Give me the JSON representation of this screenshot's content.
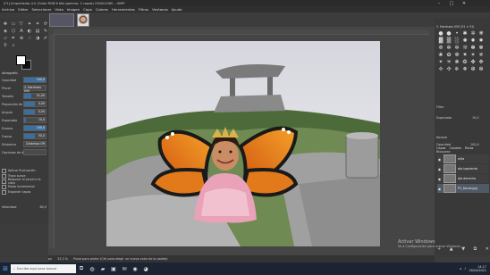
{
  "window": {
    "title": "[*1] (importada)-4.0 (Color RGB 8 bits gamma, 2 capas) 2340x1560 – GIMP",
    "controls": [
      "–",
      "□",
      "✕"
    ]
  },
  "menu": [
    "Archivo",
    "Editar",
    "Seleccionar",
    "Vista",
    "Imagen",
    "Capa",
    "Colores",
    "Herramientas",
    "Filtros",
    "Ventanas",
    "Ayuda"
  ],
  "tool_options": {
    "title": "Aerografo",
    "rows": [
      {
        "label": "Opacidad",
        "value": "100,0",
        "fill": 1.0
      },
      {
        "label": "Pincel",
        "value": "2. Hardness 050",
        "fill": 0.0
      },
      {
        "label": "Tamaño",
        "value": "51,00",
        "fill": 0.35
      },
      {
        "label": "Proporción de a...",
        "value": "0,00",
        "fill": 0.5
      },
      {
        "label": "Ángulo",
        "value": "0,00",
        "fill": 0.5
      },
      {
        "label": "Espaciado",
        "value": "10,0",
        "fill": 0.1
      },
      {
        "label": "Dureza",
        "value": "100,0",
        "fill": 1.0
      },
      {
        "label": "Fuerza",
        "value": "50,0",
        "fill": 0.5
      },
      {
        "label": "Dinámica",
        "value": "Dinámica Off",
        "fill": 0.0
      },
      {
        "label": "Opciones de dinámica",
        "value": "",
        "fill": 0.0
      }
    ],
    "checks": [
      "Aplicar fluctuación",
      "Trazo suave",
      "Bloquear el pincel a la vista",
      "Modo incremental",
      "Expandir capas"
    ],
    "footer": [
      "Velocidad",
      "80,0"
    ]
  },
  "brushes_panel": {
    "header": "2. Hardness 050 (51 × 51)",
    "filter": "Filtro",
    "mode_label": "Espaciado",
    "spacing": "10,0"
  },
  "layers_panel": {
    "tabs": [
      "Capas",
      "Canales",
      "Rutas"
    ],
    "mode": "Normal",
    "opacity_label": "Opacidad",
    "opacity": "100,0",
    "lock_label": "Bloquear:",
    "layers": [
      {
        "name": "niña",
        "selected": false
      },
      {
        "name": "ala izquierda",
        "selected": false
      },
      {
        "name": "ala derecha",
        "selected": false
      },
      {
        "name": "P1_fondo.jpg",
        "selected": true
      }
    ]
  },
  "status": {
    "unit": "px",
    "zoom": "33,3 %",
    "message": "Pulse para pintar (Ctrl para elegir un nuevo color de la paleta)"
  },
  "activate_windows": {
    "line1": "Activar Windows",
    "line2": "Ve a Configuración para activar Windows."
  },
  "taskbar": {
    "search_placeholder": "Escribe aquí para buscar",
    "time": "14:17",
    "date": "26/04/2021"
  }
}
